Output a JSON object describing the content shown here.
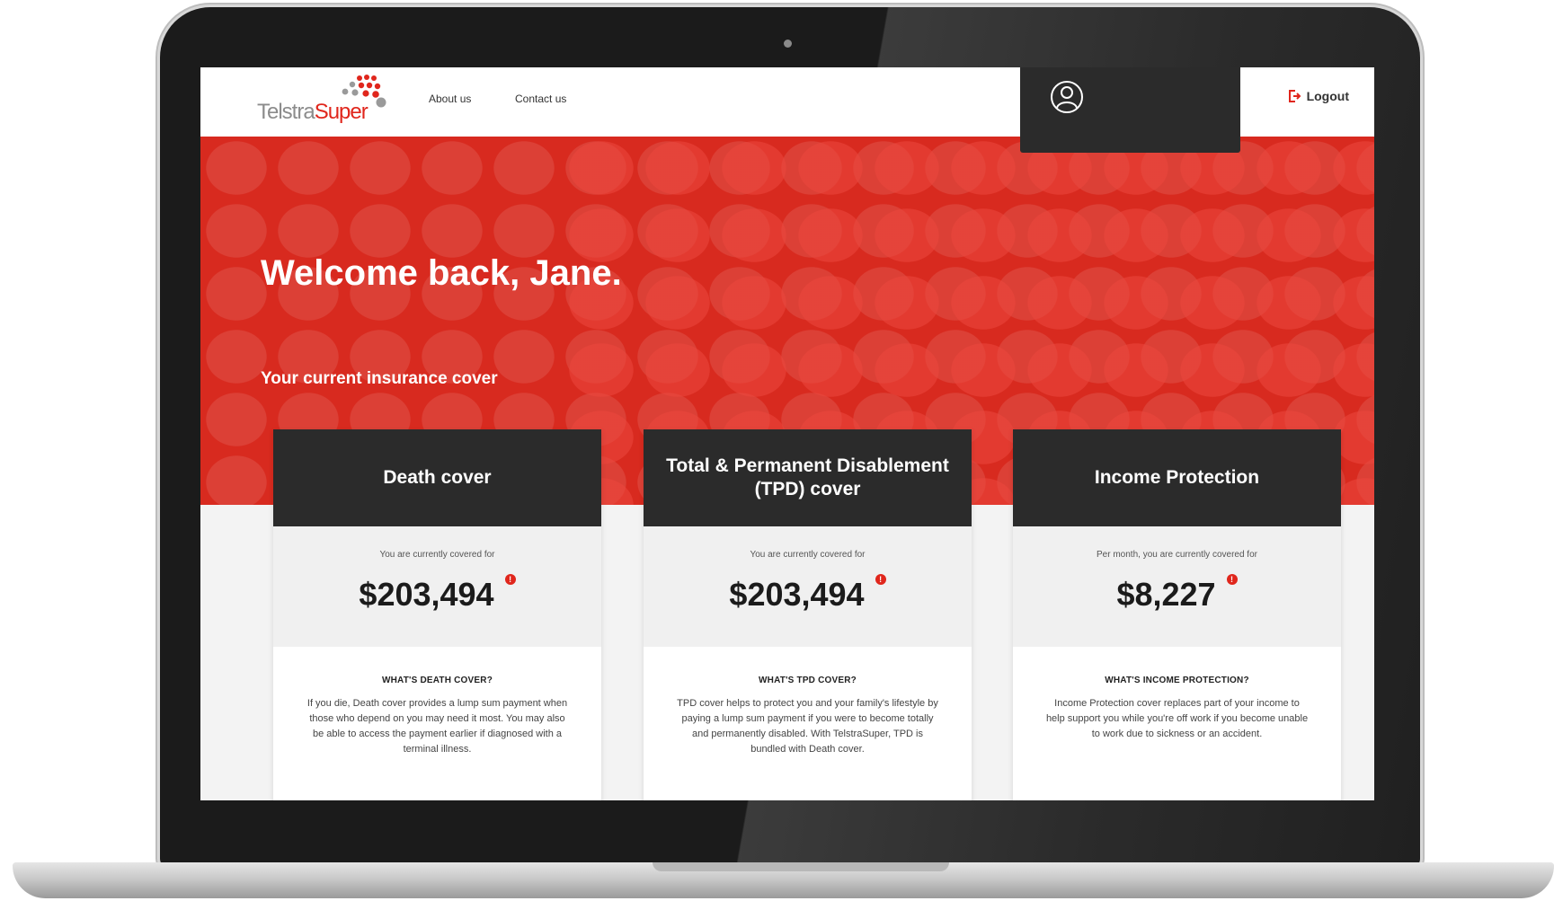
{
  "header": {
    "logo": {
      "part1": "Telstra",
      "part2": "Super"
    },
    "nav": [
      {
        "label": "About us"
      },
      {
        "label": "Contact us"
      }
    ],
    "logout_label": "Logout"
  },
  "hero": {
    "title": "Welcome back, Jane.",
    "subtitle": "Your current insurance cover"
  },
  "cards": [
    {
      "title": "Death cover",
      "caption": "You are currently covered for",
      "amount": "$203,494",
      "question": "WHAT'S DEATH COVER?",
      "description": "If you die, Death cover provides a lump sum payment when those who depend on you may need it most. You may also be able to access the payment earlier if diagnosed with a terminal illness."
    },
    {
      "title": "Total & Permanent Disablement (TPD) cover",
      "caption": "You are currently covered for",
      "amount": "$203,494",
      "question": "WHAT'S TPD COVER?",
      "description": "TPD cover helps to protect you and your family's lifestyle by paying a lump sum payment if you were to become totally and permanently disabled. With TelstraSuper, TPD is bundled with Death cover."
    },
    {
      "title": "Income Protection",
      "caption": "Per month, you are currently covered for",
      "amount": "$8,227",
      "question": "WHAT'S INCOME PROTECTION?",
      "description": "Income Protection cover replaces part of your income to help support you while you're off work if you become unable to work due to sickness or an accident."
    }
  ],
  "colors": {
    "brand_red": "#d82a1f",
    "dark_panel": "#2b2b2b",
    "info_red": "#e0261c"
  },
  "icons": {
    "user": "user-profile-icon",
    "logout": "logout-icon",
    "info": "info-icon"
  }
}
